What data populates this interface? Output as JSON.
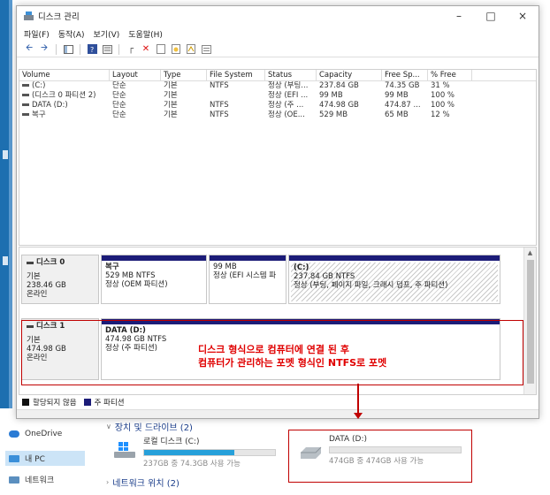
{
  "window": {
    "title": "디스크 관리",
    "controls": {
      "minimize": "–",
      "maximize": "□",
      "close": "×"
    }
  },
  "menu": [
    "파일(F)",
    "동작(A)",
    "보기(V)",
    "도움말(H)"
  ],
  "volume_list": {
    "columns": [
      "Volume",
      "Layout",
      "Type",
      "File System",
      "Status",
      "Capacity",
      "Free Sp...",
      "% Free"
    ],
    "rows": [
      [
        "(C:)",
        "단순",
        "기본",
        "NTFS",
        "정상 (부팅...",
        "237.84 GB",
        "74.35 GB",
        "31 %"
      ],
      [
        "(디스크 0 파티션 2)",
        "단순",
        "기본",
        "",
        "정상 (EFI ...",
        "99 MB",
        "99 MB",
        "100 %"
      ],
      [
        "DATA (D:)",
        "단순",
        "기본",
        "NTFS",
        "정상 (주 ...",
        "474.98 GB",
        "474.87 ...",
        "100 %"
      ],
      [
        "복구",
        "단순",
        "기본",
        "NTFS",
        "정상 (OE...",
        "529 MB",
        "65 MB",
        "12 %"
      ]
    ]
  },
  "disks": [
    {
      "name": "디스크 0",
      "kind": "기본",
      "size": "238.46 GB",
      "state": "온라인",
      "partitions": [
        {
          "name": "복구",
          "size": "529 MB NTFS",
          "status": "정상 (OEM 파티션)"
        },
        {
          "name": "",
          "size": "99 MB",
          "status": "정상 (EFI 시스템 파"
        },
        {
          "name": "(C:)",
          "size": "237.84 GB NTFS",
          "status": "정상 (부팅, 페이지 파일, 크래시 덤프, 주 파티션)"
        }
      ]
    },
    {
      "name": "디스크 1",
      "kind": "기본",
      "size": "474.98 GB",
      "state": "온라인",
      "partitions": [
        {
          "name": "DATA  (D:)",
          "size": "474.98 GB NTFS",
          "status": "정상 (주 파티션)"
        }
      ]
    }
  ],
  "annotation": {
    "line1": "디스크 형식으로 컴퓨터에 연결 된 후",
    "line2": "컴퓨터가 관리하는 포멧 형식인 NTFS로 포멧"
  },
  "legend": {
    "unallocated": "할당되지 않음",
    "primary": "주 파티션"
  },
  "explorer": {
    "nav": [
      "OneDrive",
      "내 PC",
      "네트워크"
    ],
    "sections": {
      "devices": "장치 및 드라이브 (2)",
      "network": "네트워크 위치 (2)"
    },
    "drives": [
      {
        "title": "로컬 디스크 (C:)",
        "sub": "237GB 중 74.3GB 사용 가능",
        "used_fraction": 0.69
      },
      {
        "title": "DATA (D:)",
        "sub": "474GB 중 474GB 사용 가능",
        "used_fraction": 0.0
      }
    ]
  },
  "colors": {
    "partition_cap": "#1c1c78",
    "annotation": "#e00000",
    "highlight": "#c00000",
    "drive_bar": "#26a0da",
    "legend_unallocated": "#111111",
    "legend_primary": "#1c1c78"
  }
}
